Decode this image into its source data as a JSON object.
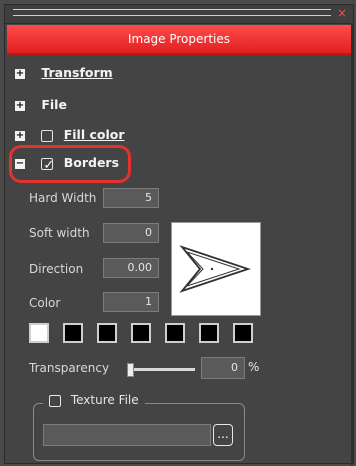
{
  "window": {
    "title": "Image Properties",
    "close_glyph": "×"
  },
  "sections": {
    "transform": {
      "label": "Transform",
      "icon": "plus"
    },
    "file": {
      "label": "File",
      "icon": "plus"
    },
    "fill_color": {
      "label": "Fill color",
      "icon": "plus",
      "checked": false
    },
    "borders": {
      "label": "Borders",
      "icon": "minus",
      "checked": true
    }
  },
  "borders": {
    "hard_width": {
      "label": "Hard Width",
      "value": "5"
    },
    "soft_width": {
      "label": "Soft width",
      "value": "0"
    },
    "direction": {
      "label": "Direction",
      "value": "0.00"
    },
    "color": {
      "label": "Color",
      "value": "1"
    },
    "transparency": {
      "label": "Transparency",
      "value": "0",
      "unit": "%",
      "level": 0
    },
    "palette": [
      "#ffffff",
      "#000000",
      "#000000",
      "#000000",
      "#000000",
      "#000000",
      "#000000"
    ]
  },
  "texture": {
    "label": "Texture File",
    "checked": false,
    "path_value": "",
    "browse_label": "..."
  },
  "colors": {
    "title_bar": "#e11f1f",
    "highlight": "#e4322f",
    "panel": "#444444"
  }
}
